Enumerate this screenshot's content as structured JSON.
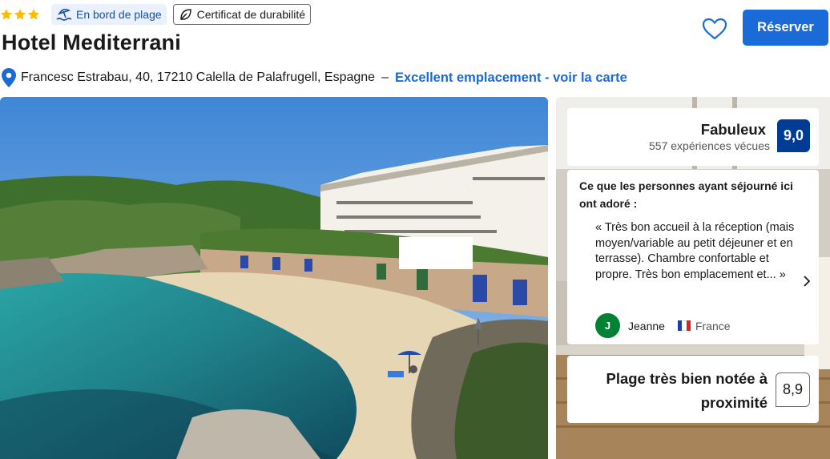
{
  "header": {
    "stars": 3,
    "badges": {
      "beach_label": "En bord de plage",
      "beach_icon": "beach-umbrella-icon",
      "certificate_label": "Certificat de durabilité",
      "certificate_icon": "eco-leaf-icon"
    },
    "hotel_name": "Hotel Mediterrani",
    "address": "Francesc Estrabau, 40, 17210 Calella de Palafrugell, Espagne",
    "separator": "–",
    "location_link": "Excellent emplacement - voir la carte",
    "reserve_label": "Réserver"
  },
  "rating": {
    "word": "Fabuleux",
    "count_text": "557 expériences vécues",
    "score": "9,0"
  },
  "review": {
    "heading": "Ce que les personnes ayant séjourné ici ont adoré :",
    "text": "« Très bon accueil à la réception (mais moyen/variable au petit déjeuner et en terrasse). Chambre confortable et propre. Très bon emplacement et... »",
    "reviewer_initial": "J",
    "reviewer_name": "Jeanne",
    "reviewer_country": "France"
  },
  "beach_rating": {
    "label": "Plage très bien notée à proximité",
    "score": "8,9"
  },
  "colors": {
    "accent": "#1a6ad8",
    "score_blue": "#003b95",
    "star_yellow": "#febb02",
    "avatar_green": "#008234"
  }
}
